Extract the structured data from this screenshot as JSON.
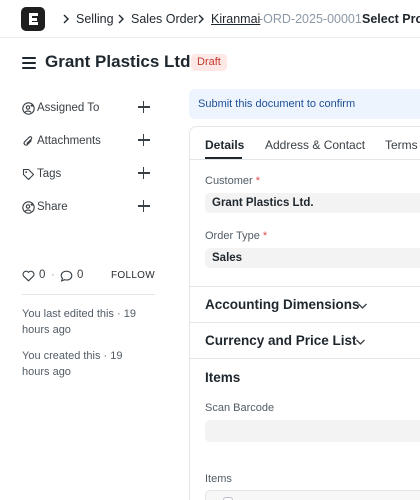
{
  "breadcrumb": {
    "items": [
      "Selling",
      "Sales Order"
    ],
    "current_prefix": "Kiranmai",
    "current_suffix": "-ORD-2025-00001",
    "trailing": "Select Proj"
  },
  "header": {
    "title": "Grant Plastics Ltd.",
    "status": "Draft"
  },
  "sidebar": {
    "items": [
      {
        "label": "Assigned To",
        "icon": "user-plus-icon"
      },
      {
        "label": "Attachments",
        "icon": "paperclip-icon"
      },
      {
        "label": "Tags",
        "icon": "tag-icon"
      },
      {
        "label": "Share",
        "icon": "share-user-icon"
      }
    ],
    "likes": "0",
    "comments": "0",
    "follow": "FOLLOW",
    "last_edited": "You last edited this · 19 hours ago",
    "created": "You created this · 19 hours ago"
  },
  "alert": {
    "message": "Submit this document to confirm"
  },
  "tabs": [
    "Details",
    "Address & Contact",
    "Terms"
  ],
  "form": {
    "customer": {
      "label": "Customer",
      "value": "Grant Plastics Ltd."
    },
    "order_type": {
      "label": "Order Type",
      "value": "Sales"
    },
    "required_marker": "*",
    "sections": {
      "accounting": "Accounting Dimensions",
      "currency": "Currency and Price List",
      "items": "Items"
    },
    "scan_barcode_label": "Scan Barcode",
    "items_table_label": "Items"
  }
}
